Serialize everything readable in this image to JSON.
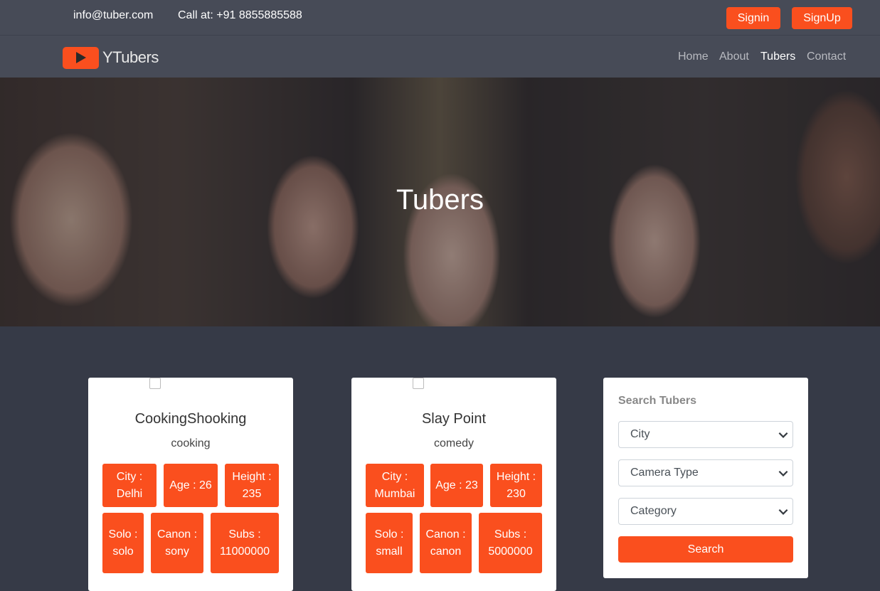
{
  "topbar": {
    "email": "info@tuber.com",
    "phone": "Call at: +91 8855885588",
    "signin_label": "Signin",
    "signup_label": "SignUp"
  },
  "navbar": {
    "brand": "YTubers",
    "links": [
      "Home",
      "About",
      "Tubers",
      "Contact"
    ],
    "active": "Tubers"
  },
  "hero": {
    "title": "Tubers"
  },
  "tubers": [
    {
      "name": "CookingShooking",
      "category": "cooking",
      "tags": [
        "City : Delhi",
        "Age : 26",
        "Height : 235",
        "Solo : solo",
        "Canon : sony",
        "Subs : 11000000"
      ]
    },
    {
      "name": "Slay Point",
      "category": "comedy",
      "tags": [
        "City : Mumbai",
        "Age : 23",
        "Height : 230",
        "Solo : small",
        "Canon : canon",
        "Subs : 5000000"
      ]
    }
  ],
  "search": {
    "heading": "Search Tubers",
    "city_select": "City",
    "camera_select": "Camera Type",
    "category_select": "Category",
    "button_label": "Search"
  },
  "colors": {
    "accent": "#fa4f1e",
    "topbar_bg": "#474b57",
    "page_bg": "#363a47"
  }
}
